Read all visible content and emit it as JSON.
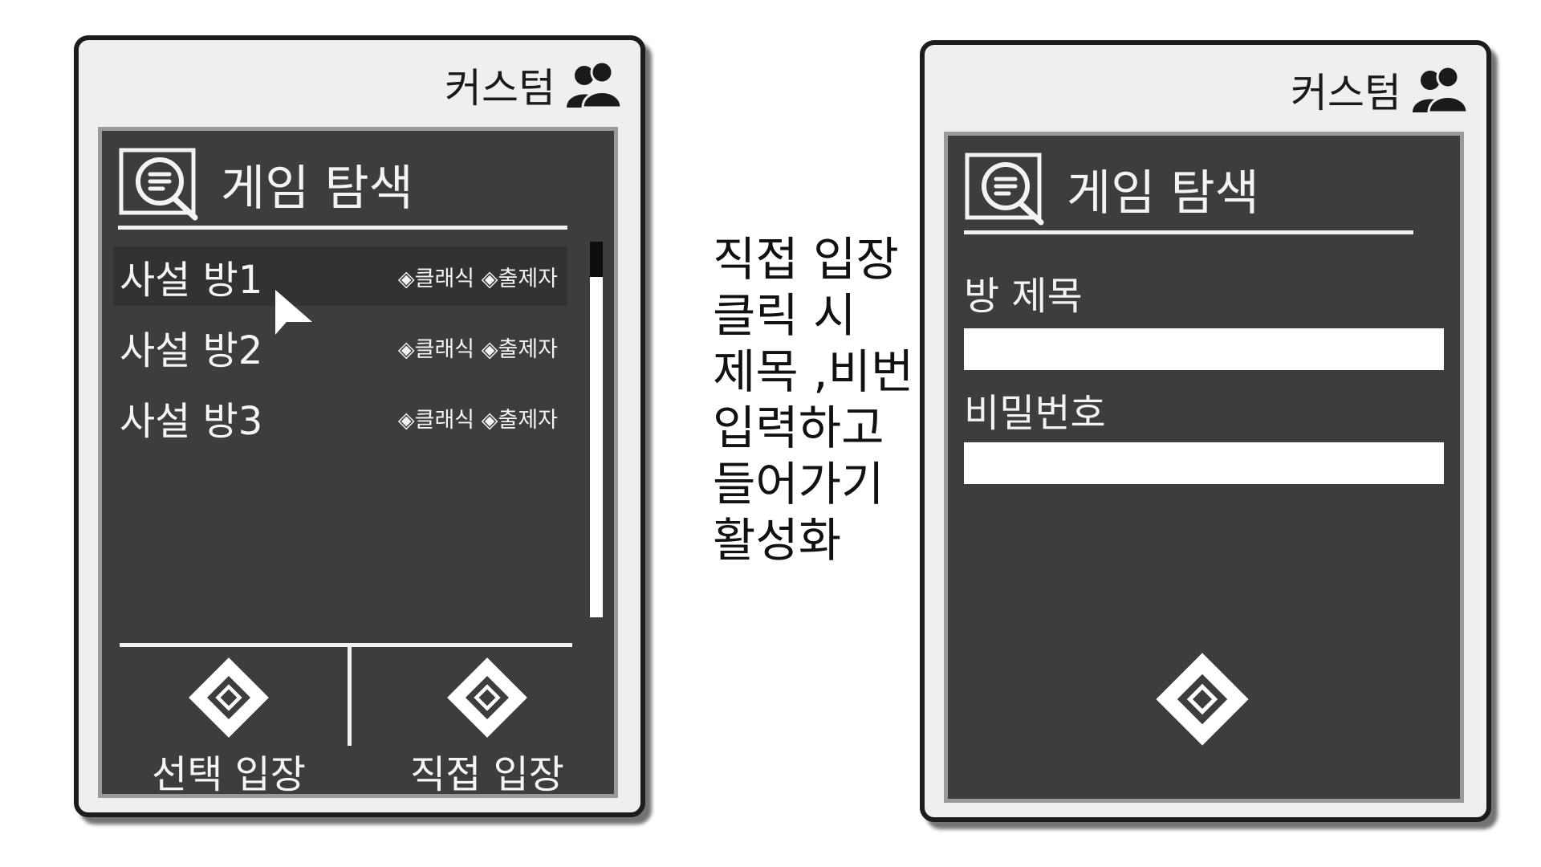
{
  "left_screen": {
    "header": {
      "label": "커스텀",
      "icon": "users-icon"
    },
    "title": "게임 탐색",
    "title_icon": "search-chat-icon",
    "rooms": [
      {
        "name": "사설 방1",
        "tags": "◈클래식 ◈출제자",
        "selected": true
      },
      {
        "name": "사설 방2",
        "tags": "◈클래식 ◈출제자",
        "selected": false
      },
      {
        "name": "사설 방3",
        "tags": "◈클래식 ◈출제자",
        "selected": false
      }
    ],
    "actions": {
      "select_enter": "선택 입장",
      "direct_enter": "직접 입장"
    }
  },
  "annotation": "직접 입장\n클릭 시\n제목 ,비번\n입력하고\n들어가기\n활성화",
  "right_screen": {
    "header": {
      "label": "커스텀",
      "icon": "users-icon"
    },
    "title": "게임 탐색",
    "title_icon": "search-chat-icon",
    "room_title_label": "방 제목",
    "password_label": "비밀번호",
    "room_title_value": "",
    "password_value": "",
    "enter_icon": "diamond-enter-icon"
  },
  "colors": {
    "screen_bg": "#3d3d3d",
    "device_bg": "#eeefee",
    "border": "#1c1c1c",
    "text_light": "#f5f5f5"
  }
}
